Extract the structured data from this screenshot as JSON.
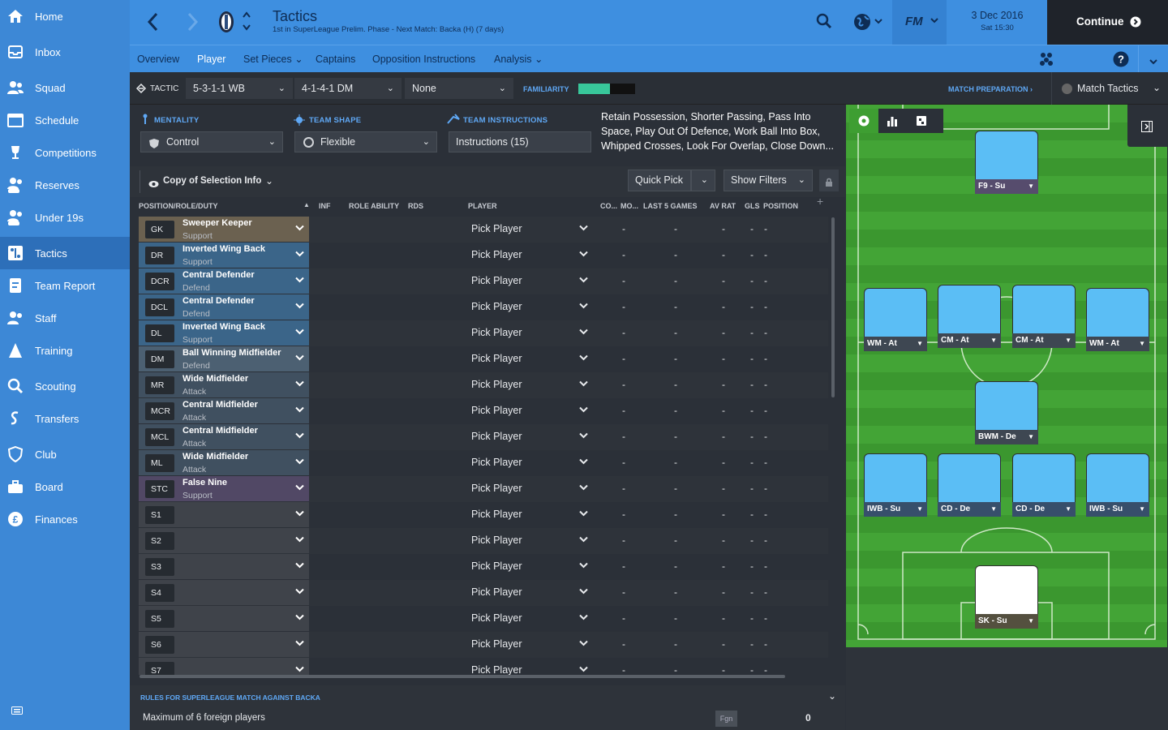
{
  "sidebar": {
    "items": [
      {
        "label": "Home",
        "icon": "home-icon"
      },
      {
        "label": "Inbox",
        "icon": "inbox-icon"
      },
      {
        "label": "Squad",
        "icon": "squad-icon"
      },
      {
        "label": "Schedule",
        "icon": "calendar-icon"
      },
      {
        "label": "Competitions",
        "icon": "trophy-icon"
      },
      {
        "label": "Reserves",
        "icon": "reserves-icon"
      },
      {
        "label": "Under 19s",
        "icon": "under19-icon"
      },
      {
        "label": "Tactics",
        "icon": "tactics-icon",
        "active": true
      },
      {
        "label": "Team Report",
        "icon": "report-icon"
      },
      {
        "label": "Staff",
        "icon": "staff-icon"
      },
      {
        "label": "Training",
        "icon": "training-icon"
      },
      {
        "label": "Scouting",
        "icon": "scouting-icon"
      },
      {
        "label": "Transfers",
        "icon": "transfers-icon"
      },
      {
        "label": "Club",
        "icon": "club-icon"
      },
      {
        "label": "Board",
        "icon": "board-icon"
      },
      {
        "label": "Finances",
        "icon": "finances-icon"
      }
    ]
  },
  "topbar": {
    "title": "Tactics",
    "subtitle": "1st in SuperLeague Prelim. Phase - Next Match: Backa (H) (7 days)",
    "date": "3 Dec 2016",
    "time": "Sat 15:30",
    "continue_label": "Continue",
    "fm_label": "FM"
  },
  "subnav": {
    "tabs": [
      {
        "label": "Overview"
      },
      {
        "label": "Player",
        "active": true
      },
      {
        "label": "Set Pieces ⌄"
      },
      {
        "label": "Captains"
      },
      {
        "label": "Opposition Instructions"
      },
      {
        "label": "Analysis ⌄"
      }
    ]
  },
  "tacticbar": {
    "tactic_caption": "TACTIC",
    "tactic1": "5-3-1-1 WB",
    "tactic2": "4-1-4-1 DM",
    "tactic3": "None",
    "familiarity_caption": "FAMILIARITY",
    "familiarity_level": 0.55,
    "match_prep": "MATCH PREPARATION ›",
    "match_tactics": "Match Tactics"
  },
  "settings": {
    "mentality_caption": "MENTALITY",
    "mentality_value": "Control",
    "shape_caption": "TEAM SHAPE",
    "shape_value": "Flexible",
    "instructions_caption": "TEAM INSTRUCTIONS",
    "instructions_value": "Instructions (15)",
    "instructions_text": "Retain Possession, Shorter Passing, Pass Into Space, Play Out Of Defence, Work Ball Into Box, Whipped Crosses, Look For Overlap, Close Down..."
  },
  "selection": {
    "view_label": "Copy of Selection Info",
    "quick_pick": "Quick Pick",
    "show_filters": "Show Filters"
  },
  "columns": {
    "position": "POSITION/ROLE/DUTY",
    "inf": "INF",
    "role_ability": "ROLE ABILITY",
    "rds": "RDS",
    "player": "PLAYER",
    "co": "CO...",
    "mo": "MO...",
    "last5": "LAST 5 GAMES",
    "avrat": "AV RAT",
    "gls": "GLS",
    "position2": "POSITION"
  },
  "rows": [
    {
      "pos": "GK",
      "role": "Sweeper Keeper",
      "duty": "Support",
      "player": "Pick Player",
      "color": "#6b6150"
    },
    {
      "pos": "DR",
      "role": "Inverted Wing Back",
      "duty": "Support",
      "player": "Pick Player",
      "color": "#3b6589"
    },
    {
      "pos": "DCR",
      "role": "Central Defender",
      "duty": "Defend",
      "player": "Pick Player",
      "color": "#3b6589"
    },
    {
      "pos": "DCL",
      "role": "Central Defender",
      "duty": "Defend",
      "player": "Pick Player",
      "color": "#3b6589"
    },
    {
      "pos": "DL",
      "role": "Inverted Wing Back",
      "duty": "Support",
      "player": "Pick Player",
      "color": "#3b6589"
    },
    {
      "pos": "DM",
      "role": "Ball Winning Midfielder",
      "duty": "Defend",
      "player": "Pick Player",
      "color": "#4c6072"
    },
    {
      "pos": "MR",
      "role": "Wide Midfielder",
      "duty": "Attack",
      "player": "Pick Player",
      "color": "#405060"
    },
    {
      "pos": "MCR",
      "role": "Central Midfielder",
      "duty": "Attack",
      "player": "Pick Player",
      "color": "#405060"
    },
    {
      "pos": "MCL",
      "role": "Central Midfielder",
      "duty": "Attack",
      "player": "Pick Player",
      "color": "#405060"
    },
    {
      "pos": "ML",
      "role": "Wide Midfielder",
      "duty": "Attack",
      "player": "Pick Player",
      "color": "#405060"
    },
    {
      "pos": "STC",
      "role": "False Nine",
      "duty": "Support",
      "player": "Pick Player",
      "color": "#514865"
    },
    {
      "pos": "S1",
      "role": "",
      "duty": "",
      "player": "Pick Player",
      "color": "#3f434a"
    },
    {
      "pos": "S2",
      "role": "",
      "duty": "",
      "player": "Pick Player",
      "color": "#3f434a"
    },
    {
      "pos": "S3",
      "role": "",
      "duty": "",
      "player": "Pick Player",
      "color": "#3f434a"
    },
    {
      "pos": "S4",
      "role": "",
      "duty": "",
      "player": "Pick Player",
      "color": "#3f434a"
    },
    {
      "pos": "S5",
      "role": "",
      "duty": "",
      "player": "Pick Player",
      "color": "#3f434a"
    },
    {
      "pos": "S6",
      "role": "",
      "duty": "",
      "player": "Pick Player",
      "color": "#3f434a"
    },
    {
      "pos": "S7",
      "role": "",
      "duty": "",
      "player": "Pick Player",
      "color": "#3f434a"
    }
  ],
  "row_dash": "-",
  "rules": {
    "title": "RULES FOR SUPERLEAGUE MATCH AGAINST BACKA",
    "rule": "Maximum of 6 foreign players",
    "badge": "Fgn",
    "count": "0"
  },
  "pitch_cards": [
    {
      "label": "F9 - Su",
      "kind": "att"
    },
    {
      "label": "WM - At",
      "kind": "mid"
    },
    {
      "label": "CM - At",
      "kind": "mid"
    },
    {
      "label": "CM - At",
      "kind": "mid"
    },
    {
      "label": "WM - At",
      "kind": "mid"
    },
    {
      "label": "BWM - De",
      "kind": "mid"
    },
    {
      "label": "IWB - Su",
      "kind": "def"
    },
    {
      "label": "CD - De",
      "kind": "def"
    },
    {
      "label": "CD - De",
      "kind": "def"
    },
    {
      "label": "IWB - Su",
      "kind": "def"
    },
    {
      "label": "SK - Su",
      "kind": "gk"
    }
  ],
  "colors": {
    "sidebar": "#3d88d6",
    "topbar": "#3e8fe0",
    "accent": "#5fa8f5",
    "pitch": "#3e9e32",
    "card": "#5bbef5"
  }
}
